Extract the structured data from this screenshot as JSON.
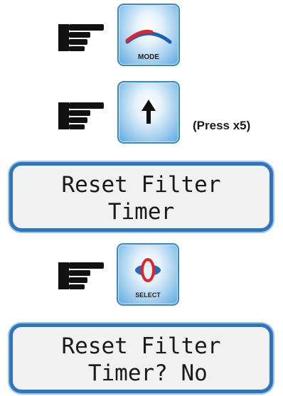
{
  "steps": {
    "mode_button": {
      "label": "MODE",
      "icon": "mode-arc-icon"
    },
    "up_button": {
      "icon": "up-arrow-icon",
      "note": "(Press x5)"
    },
    "select_button": {
      "label": "SELECT",
      "icon": "select-icon"
    }
  },
  "displays": {
    "first": {
      "line1": "Reset Filter",
      "line2": "Timer"
    },
    "second": {
      "line1": "Reset Filter",
      "line2": " Timer? No"
    }
  },
  "colors": {
    "button_border": "#3a86c6",
    "lcd_border": "#2f74bd",
    "mode_arc_red": "#e0242c",
    "mode_arc_blue": "#1f5fb0"
  }
}
